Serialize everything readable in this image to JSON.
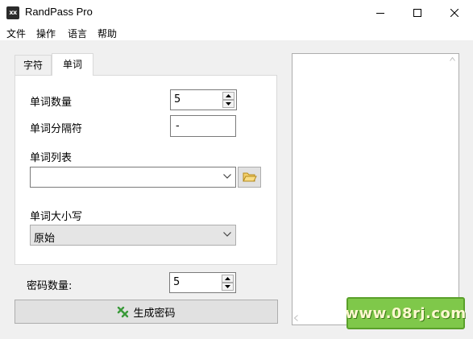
{
  "window": {
    "icon_text": "xx",
    "title": "RandPass Pro"
  },
  "menu": [
    "文件",
    "操作",
    "语言",
    "帮助"
  ],
  "tabs": [
    "字符",
    "单词"
  ],
  "words_tab": {
    "word_count_label": "单词数量",
    "word_count_value": "5",
    "separator_label": "单词分隔符",
    "separator_value": "-",
    "word_list_label": "单词列表",
    "word_list_value": "",
    "case_label": "单词大小写",
    "case_value": "原始"
  },
  "password_count_label": "密码数量:",
  "password_count_value": "5",
  "generate_label": "生成密码",
  "watermark": "www.08rj.com",
  "colors": {
    "accent_green": "#3a9a3a",
    "watermark_bg": "#7fc84a"
  },
  "icons": [
    "minimize-icon",
    "maximize-icon",
    "close-icon",
    "folder-icon",
    "generate-icon",
    "chevron-down-icon"
  ]
}
